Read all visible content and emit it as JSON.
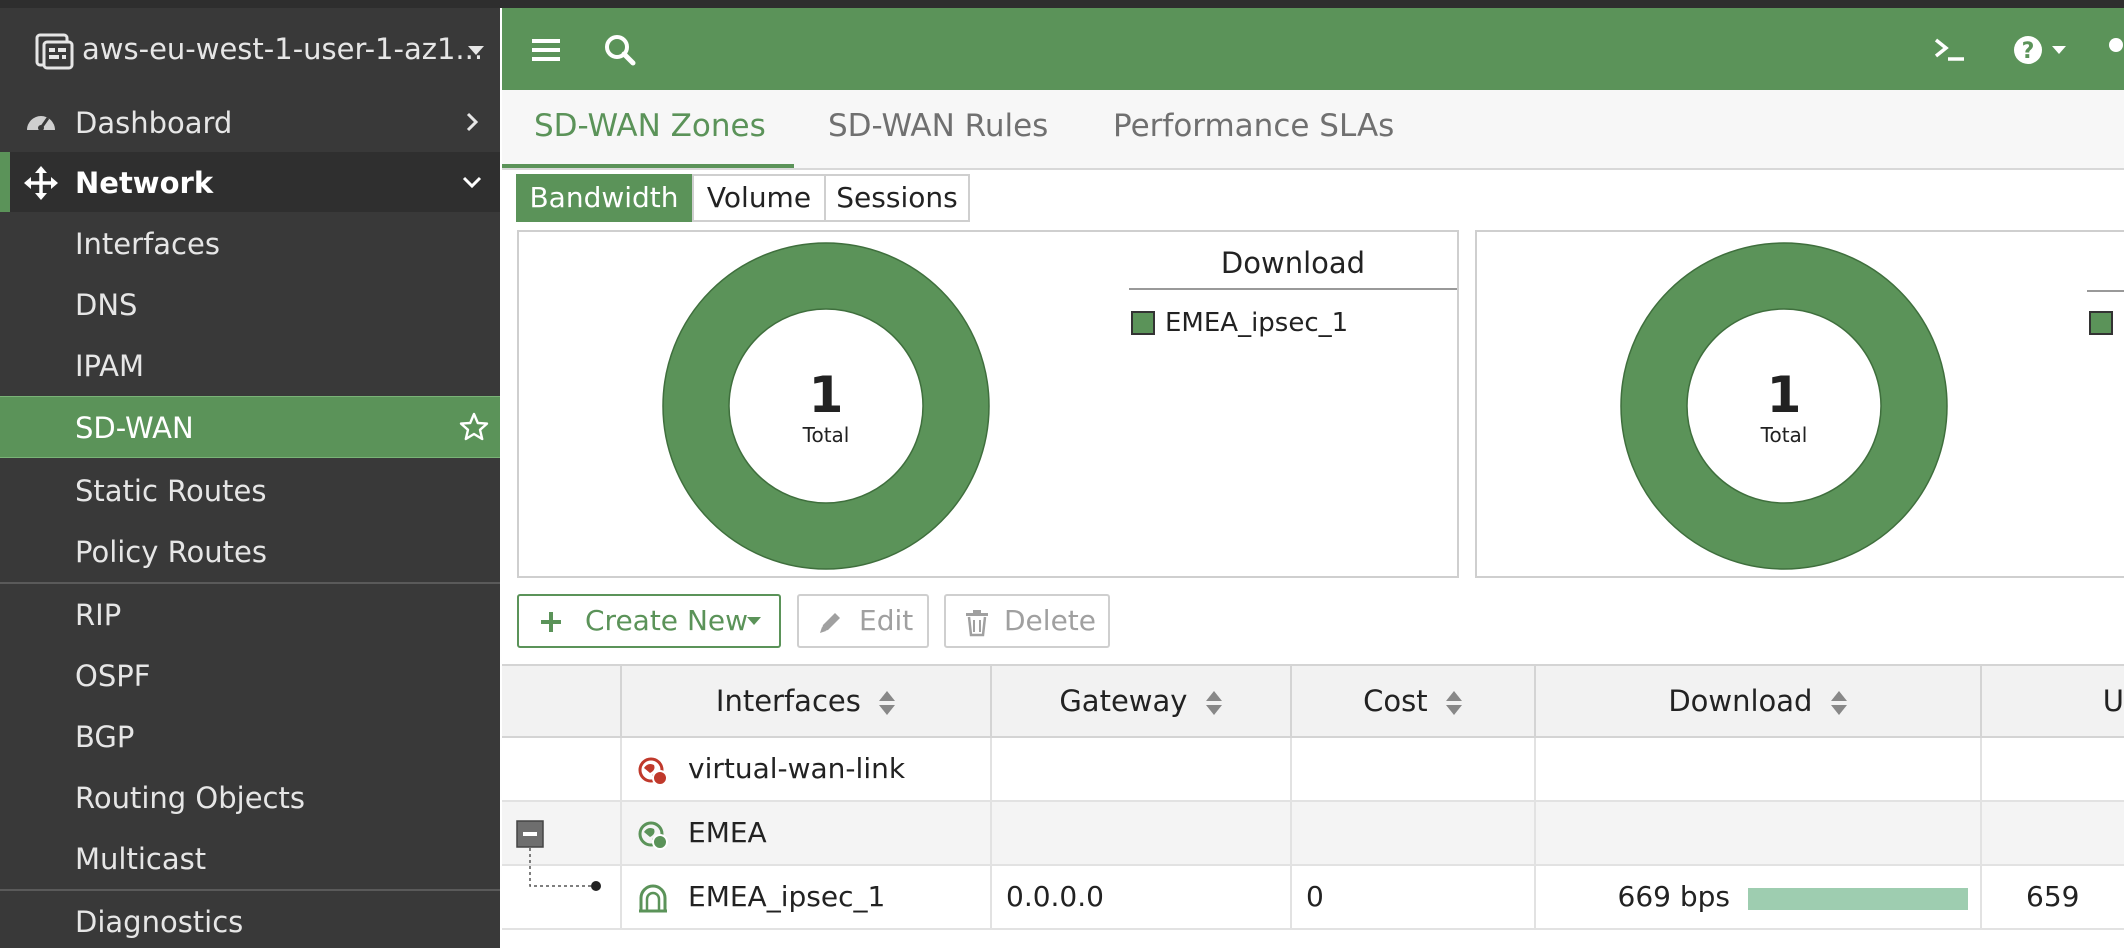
{
  "sidebar": {
    "device_name": "aws-eu-west-1-user-1-az1...",
    "items": [
      {
        "label": "Dashboard"
      },
      {
        "label": "Network"
      },
      {
        "label": "Interfaces"
      },
      {
        "label": "DNS"
      },
      {
        "label": "IPAM"
      },
      {
        "label": "SD-WAN"
      },
      {
        "label": "Static Routes"
      },
      {
        "label": "Policy Routes"
      },
      {
        "label": "RIP"
      },
      {
        "label": "OSPF"
      },
      {
        "label": "BGP"
      },
      {
        "label": "Routing Objects"
      },
      {
        "label": "Multicast"
      },
      {
        "label": "Diagnostics"
      }
    ]
  },
  "tabs": [
    {
      "label": "SD-WAN Zones"
    },
    {
      "label": "SD-WAN Rules"
    },
    {
      "label": "Performance SLAs"
    }
  ],
  "toggles": [
    {
      "label": "Bandwidth"
    },
    {
      "label": "Volume"
    },
    {
      "label": "Sessions"
    }
  ],
  "panels": [
    {
      "total": "1",
      "total_label": "Total",
      "legend_title": "Download",
      "legend": [
        "EMEA_ipsec_1"
      ]
    },
    {
      "total": "1",
      "total_label": "Total",
      "legend_title": "",
      "legend": [
        ""
      ]
    }
  ],
  "actions": {
    "create": "Create New",
    "edit": "Edit",
    "delete": "Delete"
  },
  "table": {
    "headers": [
      "Interfaces",
      "Gateway",
      "Cost",
      "Download",
      "U"
    ],
    "rows": [
      {
        "name": "virtual-wan-link",
        "gateway": "",
        "cost": "",
        "download": "",
        "upload": ""
      },
      {
        "name": "EMEA",
        "gateway": "",
        "cost": "",
        "download": "",
        "upload": ""
      },
      {
        "name": "EMEA_ipsec_1",
        "gateway": "0.0.0.0",
        "cost": "0",
        "download": "669 bps",
        "download_fraction": 1.0,
        "upload": "659"
      }
    ]
  },
  "colors": {
    "brand_green": "#5b9359",
    "sidebar_bg": "#393939",
    "bar_fill": "#9ecdb0"
  },
  "icons": [
    "device-logo-icon",
    "dashboard-gauge-icon",
    "network-move-icon",
    "star-icon",
    "hamburger-menu-icon",
    "search-icon",
    "cli-terminal-icon",
    "help-icon",
    "plus-icon",
    "pencil-icon",
    "trash-icon",
    "sort-icon",
    "wan-globe-icon",
    "collapse-minus-icon",
    "ipsec-tunnel-icon"
  ]
}
